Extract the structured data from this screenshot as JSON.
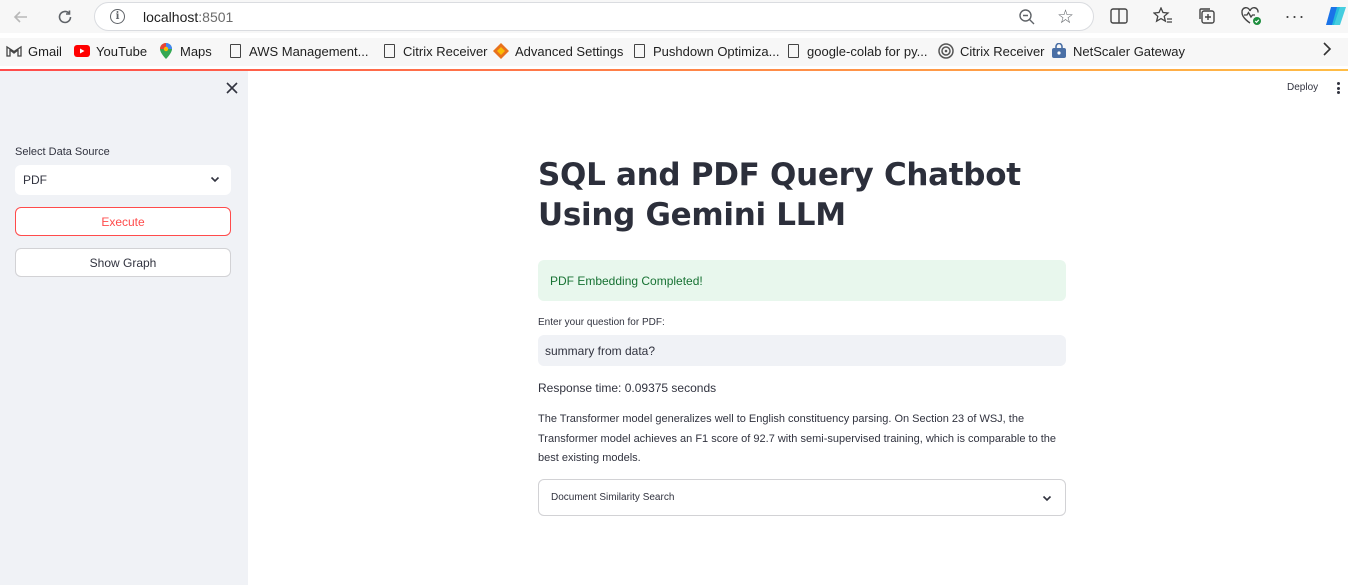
{
  "browser": {
    "url_host": "localhost",
    "url_port": ":8501",
    "icons": {
      "back": "arrow-left-icon",
      "reload": "reload-icon",
      "info": "info-icon",
      "zoom": "zoom-out-icon",
      "star": "star-icon",
      "split": "split-screen-icon",
      "favorites": "favorites-icon",
      "collections": "collections-icon",
      "health": "browser-essentials-icon",
      "more": "more-icon",
      "copilot": "copilot-icon"
    },
    "bookmarks": [
      {
        "label": "Gmail",
        "icon": "gmail-icon"
      },
      {
        "label": "YouTube",
        "icon": "youtube-icon"
      },
      {
        "label": "Maps",
        "icon": "maps-icon"
      },
      {
        "label": "AWS Management...",
        "icon": "page-icon"
      },
      {
        "label": "Citrix Receiver",
        "icon": "page-icon"
      },
      {
        "label": "Advanced Settings",
        "icon": "settings-diamond-icon"
      },
      {
        "label": "Pushdown Optimiza...",
        "icon": "page-icon"
      },
      {
        "label": "google-colab for py...",
        "icon": "page-icon"
      },
      {
        "label": "Citrix Receiver",
        "icon": "citrix-icon"
      },
      {
        "label": "NetScaler Gateway",
        "icon": "netscaler-icon"
      }
    ]
  },
  "sidebar": {
    "select_label": "Select Data Source",
    "select_value": "PDF",
    "execute_label": "Execute",
    "graph_label": "Show Graph"
  },
  "header": {
    "deploy_label": "Deploy"
  },
  "main": {
    "title": "SQL and PDF Query Chatbot Using Gemini LLM",
    "success_message": "PDF Embedding Completed!",
    "question_label": "Enter your question for PDF:",
    "question_value": "summary from data?",
    "response_time": "Response time: 0.09375 seconds",
    "answer": "The Transformer model generalizes well to English constituency parsing. On Section 23 of WSJ, the Transformer model achieves an F1 score of 92.7 with semi-supervised training, which is comparable to the best existing models.",
    "expander_label": "Document Similarity Search"
  },
  "colors": {
    "primary": "#ff4b4b",
    "success_bg": "#e8f7ed",
    "success_text": "#177233",
    "sidebar_bg": "#f0f2f6"
  }
}
